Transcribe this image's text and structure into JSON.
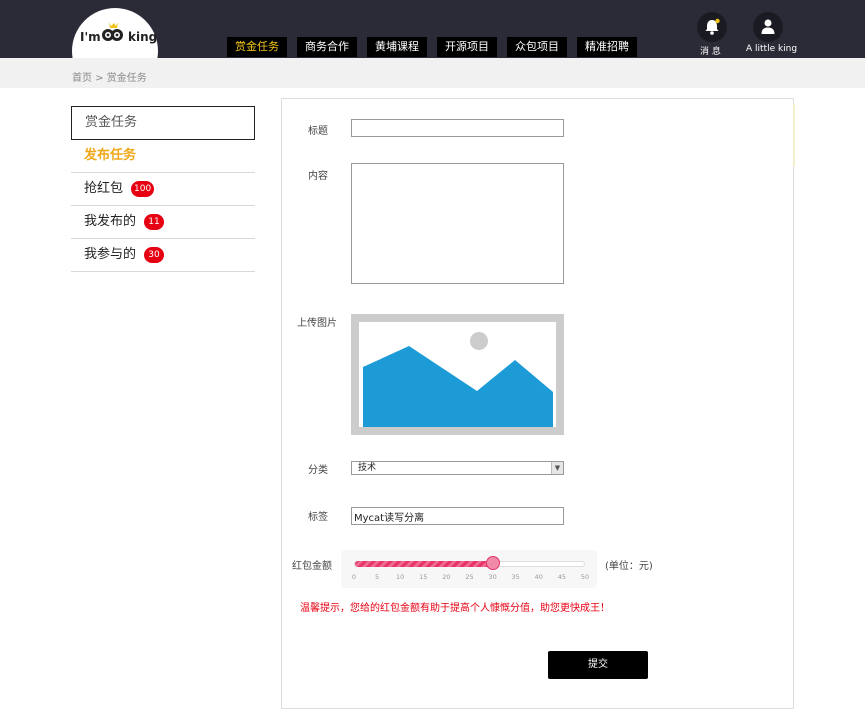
{
  "header": {
    "logo_text_left": "I'm",
    "logo_text_right": "king",
    "nav": [
      {
        "label": "赏金任务"
      },
      {
        "label": "商务合作"
      },
      {
        "label": "黄埔课程"
      },
      {
        "label": "开源项目"
      },
      {
        "label": "众包项目"
      },
      {
        "label": "精准招聘"
      }
    ],
    "messages_label": "消 息",
    "user_label": "A little king",
    "accent_color": "#f0c419"
  },
  "breadcrumb": "首页 > 赏金任务",
  "sidebar": {
    "title": "赏金任务",
    "items": [
      {
        "label": "发布任务",
        "badge": ""
      },
      {
        "label": "抢红包",
        "badge": "100"
      },
      {
        "label": "我发布的",
        "badge": "11"
      },
      {
        "label": "我参与的",
        "badge": "30"
      }
    ]
  },
  "form": {
    "title_label": "标题",
    "title_value": "",
    "content_label": "内容",
    "content_value": "",
    "image_label": "上传图片",
    "category_label": "分类",
    "category_value": "技术",
    "tag_label": "标签",
    "tag_value": "Mycat读写分离",
    "amount_label": "红包金额",
    "amount_value": 30,
    "amount_ticks": [
      "0",
      "5",
      "10",
      "15",
      "20",
      "25",
      "30",
      "35",
      "40",
      "45",
      "50"
    ],
    "amount_unit": "(单位：元)",
    "tip": "温馨提示，您给的红包金额有助于提高个人慷慨分值，助您更快成王！",
    "submit_label": "提交"
  }
}
